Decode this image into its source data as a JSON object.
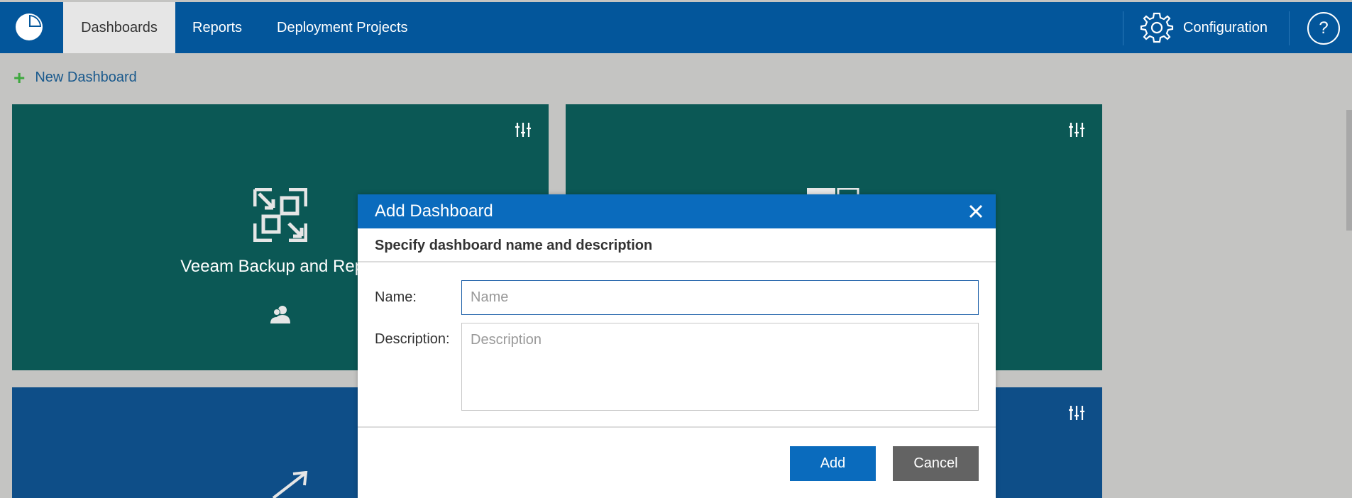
{
  "nav": {
    "tabs": [
      {
        "label": "Dashboards",
        "active": true
      },
      {
        "label": "Reports"
      },
      {
        "label": "Deployment Projects"
      }
    ],
    "configuration_label": "Configuration",
    "help_label": "?"
  },
  "toolbar": {
    "new_dashboard_label": "New Dashboard"
  },
  "tiles": [
    {
      "title": "Veeam Backup and Replic",
      "color": "#0b5855"
    },
    {
      "title": "",
      "color": "#0b5855"
    },
    {
      "title": "",
      "color": "#0e4e88"
    },
    {
      "title": "",
      "color": "#0e4e88"
    }
  ],
  "dialog": {
    "title": "Add Dashboard",
    "subtitle": "Specify dashboard name and description",
    "name_label": "Name:",
    "name_placeholder": "Name",
    "description_label": "Description:",
    "description_placeholder": "Description",
    "add_label": "Add",
    "cancel_label": "Cancel"
  },
  "colors": {
    "topbar": "#03569b",
    "accent": "#0a6bbd",
    "cancel": "#636363",
    "tile_green": "#0b5855",
    "tile_blue": "#0e4e88"
  }
}
